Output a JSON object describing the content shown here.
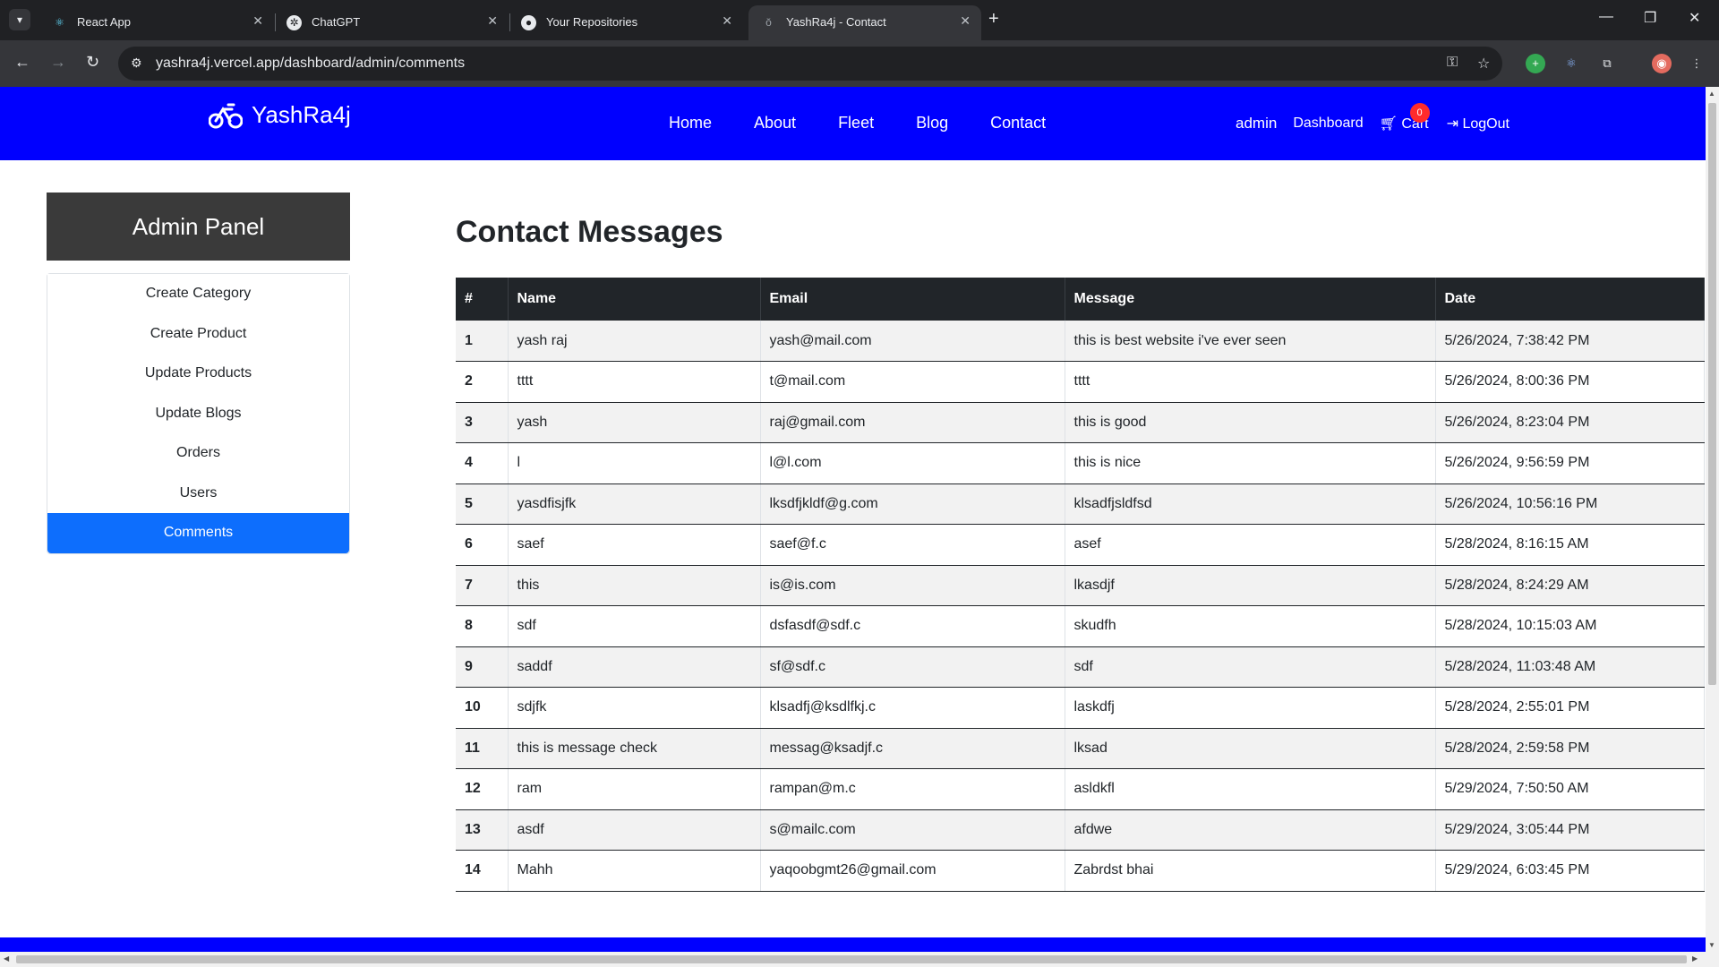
{
  "browser": {
    "tabs": [
      {
        "title": "React App",
        "icon": "react-icon"
      },
      {
        "title": "ChatGPT",
        "icon": "chatgpt-icon"
      },
      {
        "title": "Your Repositories",
        "icon": "github-icon"
      },
      {
        "title": "YashRa4j - Contact",
        "icon": "bike-icon",
        "active": true
      }
    ],
    "url": "yashra4j.vercel.app/dashboard/admin/comments"
  },
  "navbar": {
    "brand": "YashRa4j",
    "links": [
      "Home",
      "About",
      "Fleet",
      "Blog",
      "Contact"
    ],
    "user": "admin",
    "dashboard": "Dashboard",
    "cart_label": "Cart",
    "cart_count": "0",
    "logout": "LogOut"
  },
  "sidebar": {
    "title": "Admin Panel",
    "items": [
      {
        "label": "Create Category"
      },
      {
        "label": "Create Product"
      },
      {
        "label": "Update Products"
      },
      {
        "label": "Update Blogs"
      },
      {
        "label": "Orders"
      },
      {
        "label": "Users"
      },
      {
        "label": "Comments",
        "active": true
      }
    ]
  },
  "main": {
    "title": "Contact Messages",
    "columns": [
      "#",
      "Name",
      "Email",
      "Message",
      "Date"
    ],
    "rows": [
      [
        "1",
        "yash raj",
        "yash@mail.com",
        "this is best website i've ever seen",
        "5/26/2024, 7:38:42 PM"
      ],
      [
        "2",
        "tttt",
        "t@mail.com",
        "tttt",
        "5/26/2024, 8:00:36 PM"
      ],
      [
        "3",
        "yash",
        "raj@gmail.com",
        "this is good",
        "5/26/2024, 8:23:04 PM"
      ],
      [
        "4",
        "l",
        "l@l.com",
        "this is nice",
        "5/26/2024, 9:56:59 PM"
      ],
      [
        "5",
        "yasdfisjfk",
        "lksdfjkldf@g.com",
        "klsadfjsldfsd",
        "5/26/2024, 10:56:16 PM"
      ],
      [
        "6",
        "saef",
        "saef@f.c",
        "asef",
        "5/28/2024, 8:16:15 AM"
      ],
      [
        "7",
        "this",
        "is@is.com",
        "lkasdjf",
        "5/28/2024, 8:24:29 AM"
      ],
      [
        "8",
        "sdf",
        "dsfasdf@sdf.c",
        "skudfh",
        "5/28/2024, 10:15:03 AM"
      ],
      [
        "9",
        "saddf",
        "sf@sdf.c",
        "sdf",
        "5/28/2024, 11:03:48 AM"
      ],
      [
        "10",
        "sdjfk",
        "klsadfj@ksdlfkj.c",
        "laskdfj",
        "5/28/2024, 2:55:01 PM"
      ],
      [
        "11",
        "this is message check",
        "messag@ksadjf.c",
        "lksad",
        "5/28/2024, 2:59:58 PM"
      ],
      [
        "12",
        "ram",
        "rampan@m.c",
        "asldkfl",
        "5/29/2024, 7:50:50 AM"
      ],
      [
        "13",
        "asdf",
        "s@mailc.com",
        "afdwe",
        "5/29/2024, 3:05:44 PM"
      ],
      [
        "14",
        "Mahh",
        "yaqoobgmt26@gmail.com",
        "Zabrdst bhai",
        "5/29/2024, 6:03:45 PM"
      ]
    ]
  },
  "colors": {
    "navbar": "#0000ff",
    "panel_header": "#3a3a3a",
    "active_item": "#0d6efd",
    "table_header": "#212529"
  }
}
